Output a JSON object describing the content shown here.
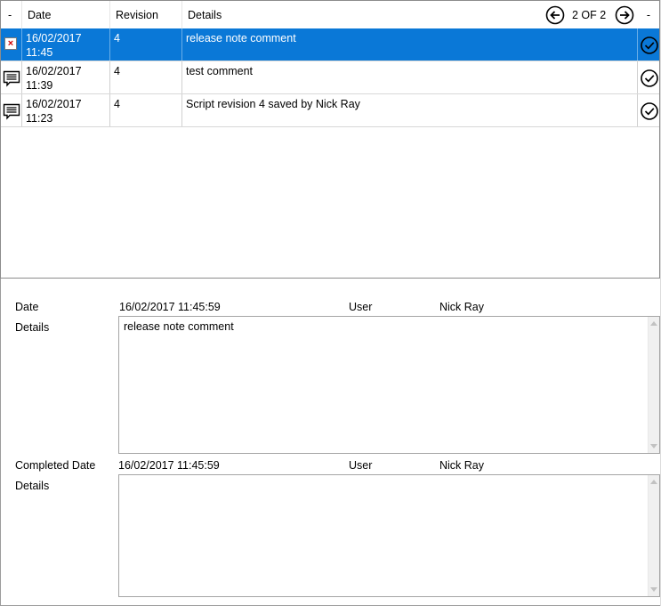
{
  "grid": {
    "headers": {
      "col0": "-",
      "date": "Date",
      "revision": "Revision",
      "details": "Details",
      "col_last": "-"
    },
    "pager": {
      "text": "2 OF 2",
      "prev_icon": "arrow-left-circle-icon",
      "next_icon": "arrow-right-circle-icon"
    },
    "rows": [
      {
        "icon": "delete-x-icon",
        "date_line1": "16/02/2017",
        "date_line2": "11:45",
        "revision": "4",
        "details": "release note comment",
        "status_icon": "check-circle-icon",
        "selected": true
      },
      {
        "icon": "comment-icon",
        "date_line1": "16/02/2017",
        "date_line2": "11:39",
        "revision": "4",
        "details": "test comment",
        "status_icon": "check-circle-icon",
        "selected": false
      },
      {
        "icon": "comment-icon",
        "date_line1": "16/02/2017",
        "date_line2": "11:23",
        "revision": "4",
        "details": "Script revision 4 saved by Nick Ray",
        "status_icon": "check-circle-icon",
        "selected": false
      }
    ],
    "selection_color": "#0a78d7"
  },
  "detail": {
    "date_label": "Date",
    "date_value": "16/02/2017 11:45:59",
    "user_label": "User",
    "user_value": "Nick Ray",
    "details_label": "Details",
    "details_value": "release note comment",
    "completed_date_label": "Completed Date",
    "completed_date_value": "16/02/2017 11:45:59",
    "completed_user_label": "User",
    "completed_user_value": "Nick Ray",
    "completed_details_label": "Details",
    "completed_details_value": ""
  }
}
